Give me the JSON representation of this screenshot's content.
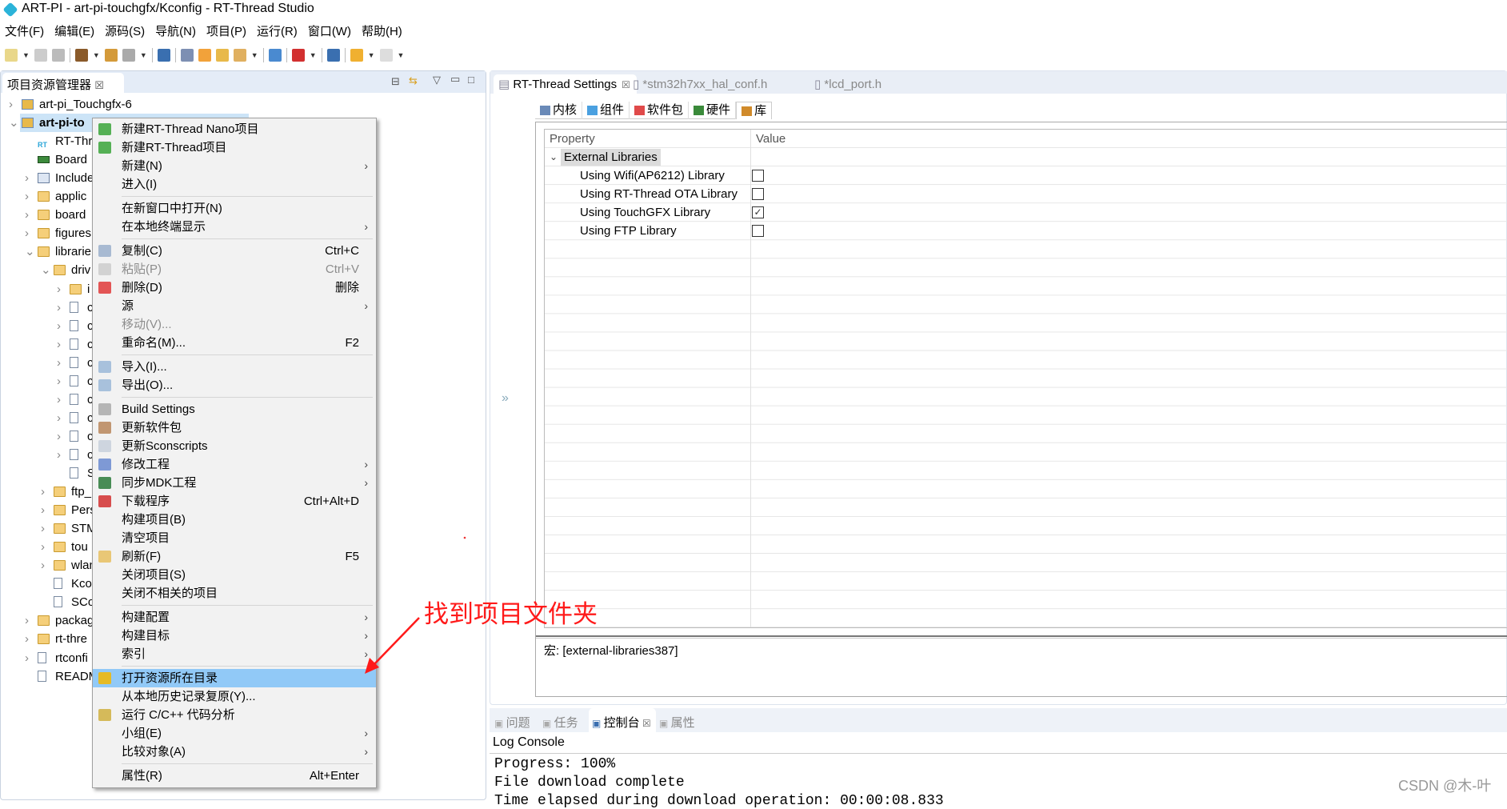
{
  "window": {
    "title": "ART-PI - art-pi-touchgfx/Kconfig - RT-Thread Studio"
  },
  "menubar": [
    "文件(F)",
    "编辑(E)",
    "源码(S)",
    "导航(N)",
    "项目(P)",
    "运行(R)",
    "窗口(W)",
    "帮助(H)"
  ],
  "toolbar": [
    {
      "icon": "new-icon",
      "color": "#e9d78a",
      "dd": true
    },
    {
      "icon": "save-icon",
      "color": "#ccc"
    },
    {
      "icon": "save-all-icon",
      "color": "#bbb",
      "sep": true
    },
    {
      "icon": "build-hammer-icon",
      "color": "#8a5a2a",
      "dd": true
    },
    {
      "icon": "rebuild-icon",
      "color": "#d49a3a"
    },
    {
      "icon": "wrench-icon",
      "color": "#aaa",
      "dd": true,
      "sep": true
    },
    {
      "icon": "monitor-icon",
      "color": "#3a6fb0",
      "sep": true
    },
    {
      "icon": "gear-icon",
      "color": "#7d8fb3"
    },
    {
      "icon": "debug-bug-icon",
      "color": "#f2a23a"
    },
    {
      "icon": "open-folder-icon",
      "color": "#e8b94a"
    },
    {
      "icon": "rocket-icon",
      "color": "#e0b060",
      "dd": true,
      "sep": true
    },
    {
      "icon": "book-icon",
      "color": "#4a8ad0",
      "sep": true
    },
    {
      "icon": "download-icon",
      "color": "#d23030",
      "dd": true,
      "sep": true
    },
    {
      "icon": "window-icon",
      "color": "#3a6fb0",
      "sep": true
    },
    {
      "icon": "back-arrow-icon",
      "color": "#f0b030",
      "dd": true
    },
    {
      "icon": "forward-arrow-icon",
      "color": "#ddd",
      "dd": true
    }
  ],
  "explorer": {
    "tab": "项目资源管理器",
    "tree": [
      {
        "label": "art-pi_Touchgfx-6",
        "level": 0,
        "arrow": ">",
        "icon": "proj"
      },
      {
        "label": "art-pi-to",
        "level": 0,
        "arrow": "v",
        "icon": "proj",
        "selected": true,
        "bold": true
      },
      {
        "label": "RT-Thr",
        "level": 1,
        "icon": "rt"
      },
      {
        "label": "Board",
        "level": 1,
        "icon": "board"
      },
      {
        "label": "Include",
        "level": 1,
        "arrow": ">",
        "icon": "inc"
      },
      {
        "label": "applic",
        "level": 1,
        "arrow": ">",
        "icon": "folder"
      },
      {
        "label": "board",
        "level": 1,
        "arrow": ">",
        "icon": "folder"
      },
      {
        "label": "figures",
        "level": 1,
        "arrow": ">",
        "icon": "folder"
      },
      {
        "label": "librarie",
        "level": 1,
        "arrow": "v",
        "icon": "folder"
      },
      {
        "label": "driv",
        "level": 2,
        "arrow": "v",
        "icon": "folder"
      },
      {
        "label": "i",
        "level": 3,
        "arrow": ">",
        "icon": "folder"
      },
      {
        "label": "c",
        "level": 3,
        "arrow": ">",
        "icon": "file"
      },
      {
        "label": "c",
        "level": 3,
        "arrow": ">",
        "icon": "file"
      },
      {
        "label": "c",
        "level": 3,
        "arrow": ">",
        "icon": "file"
      },
      {
        "label": "c",
        "level": 3,
        "arrow": ">",
        "icon": "file"
      },
      {
        "label": "c",
        "level": 3,
        "arrow": ">",
        "icon": "file"
      },
      {
        "label": "c",
        "level": 3,
        "arrow": ">",
        "icon": "file"
      },
      {
        "label": "c",
        "level": 3,
        "arrow": ">",
        "icon": "file"
      },
      {
        "label": "c",
        "level": 3,
        "arrow": ">",
        "icon": "file"
      },
      {
        "label": "c",
        "level": 3,
        "arrow": ">",
        "icon": "file"
      },
      {
        "label": "S",
        "level": 3,
        "icon": "file"
      },
      {
        "label": "ftp_",
        "level": 2,
        "arrow": ">",
        "icon": "folder"
      },
      {
        "label": "Pers",
        "level": 2,
        "arrow": ">",
        "icon": "folder"
      },
      {
        "label": "STM",
        "level": 2,
        "arrow": ">",
        "icon": "folder"
      },
      {
        "label": "tou",
        "level": 2,
        "arrow": ">",
        "icon": "folder"
      },
      {
        "label": "wlan",
        "level": 2,
        "arrow": ">",
        "icon": "folder"
      },
      {
        "label": "Kco",
        "level": 2,
        "icon": "file"
      },
      {
        "label": "SCo",
        "level": 2,
        "icon": "file"
      },
      {
        "label": "packag",
        "level": 1,
        "arrow": ">",
        "icon": "folder"
      },
      {
        "label": "rt-thre",
        "level": 1,
        "arrow": ">",
        "icon": "folder"
      },
      {
        "label": "rtconfi",
        "level": 1,
        "arrow": ">",
        "icon": "file"
      },
      {
        "label": "READM",
        "level": 1,
        "icon": "file"
      }
    ]
  },
  "context_menu": [
    {
      "label": "新建RT-Thread Nano项目",
      "icon": "new-project-icon",
      "color": "#3aa53a"
    },
    {
      "label": "新建RT-Thread项目",
      "icon": "new-project-icon",
      "color": "#3aa53a"
    },
    {
      "label": "新建(N)",
      "submenu": true
    },
    {
      "label": "进入(I)"
    },
    {
      "sep": true
    },
    {
      "label": "在新窗口中打开(N)"
    },
    {
      "label": "在本地终端显示",
      "submenu": true
    },
    {
      "sep": true
    },
    {
      "label": "复制(C)",
      "shortcut": "Ctrl+C",
      "icon": "copy-icon",
      "color": "#9bb0cc"
    },
    {
      "label": "粘贴(P)",
      "shortcut": "Ctrl+V",
      "icon": "paste-icon",
      "color": "#ccc",
      "disabled": true
    },
    {
      "label": "删除(D)",
      "shortcut": "删除",
      "icon": "delete-icon",
      "color": "#e03a3a"
    },
    {
      "label": "源",
      "submenu": true
    },
    {
      "label": "移动(V)...",
      "disabled": true
    },
    {
      "label": "重命名(M)...",
      "shortcut": "F2"
    },
    {
      "sep": true
    },
    {
      "label": "导入(I)...",
      "icon": "import-icon",
      "color": "#9bb8d8"
    },
    {
      "label": "导出(O)...",
      "icon": "export-icon",
      "color": "#9bb8d8"
    },
    {
      "sep": true
    },
    {
      "label": "Build Settings",
      "icon": "wrench-icon",
      "color": "#aaa"
    },
    {
      "label": "更新软件包",
      "icon": "package-icon",
      "color": "#b8865a"
    },
    {
      "label": "更新Sconscripts",
      "icon": "file-icon",
      "color": "#c8d0dc"
    },
    {
      "label": "修改工程",
      "submenu": true,
      "icon": "modify-icon",
      "color": "#6a8ad0"
    },
    {
      "label": "同步MDK工程",
      "submenu": true,
      "icon": "mdk-icon",
      "color": "#2a7a3a"
    },
    {
      "label": "下载程序",
      "shortcut": "Ctrl+Alt+D",
      "icon": "download-icon",
      "color": "#d23030"
    },
    {
      "label": "构建项目(B)"
    },
    {
      "label": "清空项目"
    },
    {
      "label": "刷新(F)",
      "shortcut": "F5",
      "icon": "refresh-icon",
      "color": "#e8c060"
    },
    {
      "label": "关闭项目(S)"
    },
    {
      "label": "关闭不相关的项目"
    },
    {
      "sep": true
    },
    {
      "label": "构建配置",
      "submenu": true
    },
    {
      "label": "构建目标",
      "submenu": true
    },
    {
      "label": "索引",
      "submenu": true
    },
    {
      "sep": true
    },
    {
      "label": "打开资源所在目录",
      "highlight": true,
      "icon": "folder-icon",
      "color": "#f5b700"
    },
    {
      "label": "从本地历史记录复原(Y)..."
    },
    {
      "label": "运行 C/C++ 代码分析",
      "icon": "code-analysis-icon",
      "color": "#d0b040"
    },
    {
      "label": "小组(E)",
      "submenu": true
    },
    {
      "label": "比较对象(A)",
      "submenu": true
    },
    {
      "sep": true
    },
    {
      "label": "属性(R)",
      "shortcut": "Alt+Enter"
    }
  ],
  "editor": {
    "tabs": [
      {
        "label": "RT-Thread Settings",
        "active": true,
        "close": "☒"
      },
      {
        "label": "*stm32h7xx_hal_conf.h"
      },
      {
        "label": "*lcd_port.h"
      }
    ],
    "subtabs": [
      {
        "label": "内核",
        "color": "#6a8ab8"
      },
      {
        "label": "组件",
        "color": "#4aa0e0"
      },
      {
        "label": "软件包",
        "color": "#e04a4a"
      },
      {
        "label": "硬件",
        "color": "#3a8a3a"
      },
      {
        "label": "库",
        "color": "#d08a2a"
      }
    ],
    "grid": {
      "col_property": "Property",
      "col_value": "Value",
      "group": "External Libraries",
      "rows": [
        {
          "label": "Using Wifi(AP6212) Library",
          "checked": false
        },
        {
          "label": "Using RT-Thread OTA Library",
          "checked": false
        },
        {
          "label": "Using TouchGFX Library",
          "checked": true
        },
        {
          "label": "Using FTP Library",
          "checked": false
        }
      ]
    },
    "macro": "宏: [external-libraries387]",
    "collapse": "»"
  },
  "bottom": {
    "tabs": [
      "问题",
      "任务",
      "控制台",
      "属性"
    ],
    "active_tab": "控制台",
    "console_title": "Log Console",
    "lines": [
      "Progress: 100%",
      "File download complete",
      "Time elapsed during download operation: 00:00:08.833"
    ]
  },
  "annotation": {
    "text": "找到项目文件夹",
    "color": "#ff1a1a"
  },
  "watermark": "CSDN @木-叶"
}
